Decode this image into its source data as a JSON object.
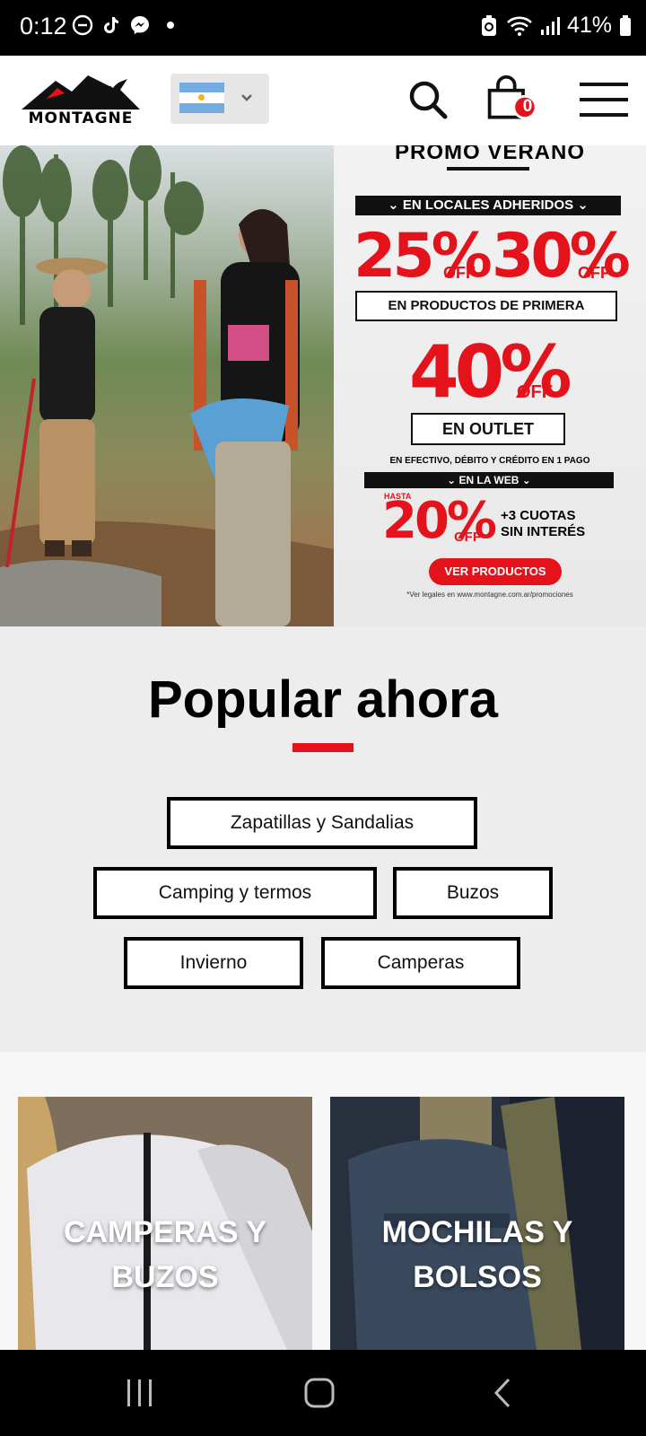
{
  "status_bar": {
    "time": "0:12",
    "battery": "41%",
    "left_icons": [
      "do-not-disturb-icon",
      "tiktok-icon",
      "messenger-icon",
      "notification-dot"
    ],
    "right_icons": [
      "battery-saver-icon",
      "wifi-icon",
      "signal-icon",
      "battery-icon"
    ]
  },
  "header": {
    "logo_text": "MONTAGNE",
    "country": "Argentina",
    "cart_count": "0",
    "colors": {
      "accent": "#e3121b"
    }
  },
  "hero": {
    "promo_title": "PROMO VERANO",
    "stores_label": "EN LOCALES ADHERIDOS",
    "pct_25": "25%",
    "pct_30": "30%",
    "off": "OFF",
    "asterisk": "*",
    "first_quality": "EN PRODUCTOS DE PRIMERA",
    "pct_40": "40%",
    "outlet": "EN OUTLET",
    "payment_note": "EN EFECTIVO, DÉBITO Y CRÉDITO EN 1 PAGO",
    "web_label": "EN LA WEB",
    "hasta": "HASTA",
    "pct_20": "20%",
    "installments_line1": "+3 CUOTAS",
    "installments_line2": "SIN INTERÉS",
    "cta": "VER PRODUCTOS",
    "legal": "*Ver legales en www.montagne.com.ar/promociones"
  },
  "popular": {
    "title": "Popular ahora",
    "chips": [
      "Zapatillas y Sandalias",
      "Camping y termos",
      "Buzos",
      "Invierno",
      "Camperas"
    ]
  },
  "categories": [
    {
      "line1": "CAMPERAS Y",
      "line2": "BUZOS"
    },
    {
      "line1": "MOCHILAS Y",
      "line2": "BOLSOS"
    }
  ]
}
